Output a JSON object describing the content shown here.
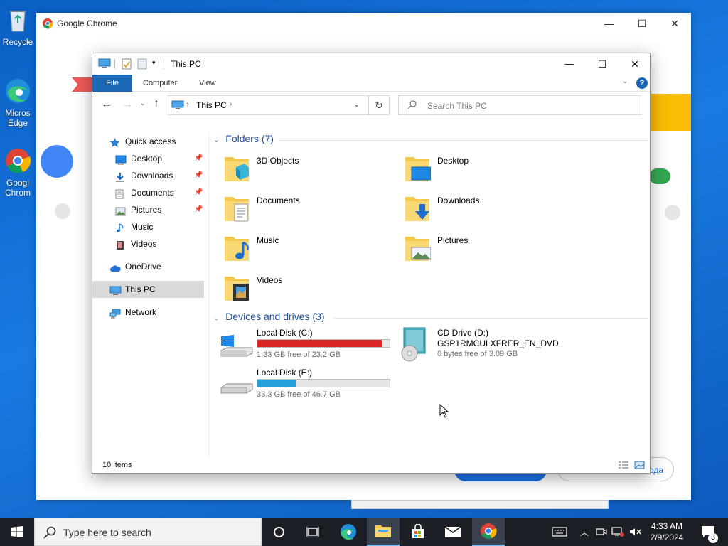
{
  "desktop": {
    "icons": [
      {
        "label": "Recycle"
      },
      {
        "label": "Micros Edge"
      },
      {
        "label": "Googl Chrom"
      }
    ]
  },
  "chrome_window": {
    "title": "Google Chrome",
    "buttons": {
      "minimize": "—",
      "maximize": "☐",
      "close": "✕"
    },
    "background_text": "ода"
  },
  "explorer": {
    "title": "This PC",
    "ribbon_tabs": [
      "File",
      "Computer",
      "View"
    ],
    "help": "?",
    "address": {
      "location": "This PC",
      "search_placeholder": "Search This PC"
    },
    "nav": {
      "quick_access": "Quick access",
      "pinned": [
        "Desktop",
        "Downloads",
        "Documents",
        "Pictures"
      ],
      "unpinned": [
        "Music",
        "Videos"
      ],
      "onedrive": "OneDrive",
      "this_pc": "This PC",
      "network": "Network"
    },
    "folders_header": "Folders (7)",
    "folders": [
      "3D Objects",
      "Desktop",
      "Documents",
      "Downloads",
      "Music",
      "Pictures",
      "Videos"
    ],
    "devices_header": "Devices and drives (3)",
    "drives": [
      {
        "name": "Local Disk (C:)",
        "free": "1.33 GB free of 23.2 GB",
        "used_fraction": 0.94,
        "color": "#da2626"
      },
      {
        "name": "CD Drive (D:)",
        "label": "GSP1RMCULXFRER_EN_DVD",
        "free": "0 bytes free of 3.09 GB"
      },
      {
        "name": "Local Disk (E:)",
        "free": "33.3 GB free of 46.7 GB",
        "used_fraction": 0.29,
        "color": "#26a0da"
      }
    ],
    "status": "10 items"
  },
  "taskbar": {
    "search_placeholder": "Type here to search",
    "time": "4:33 AM",
    "date": "2/9/2024",
    "notification_count": "3"
  },
  "colors": {
    "accent": "#1a67b5",
    "folder": "#f4c64c",
    "taskbar": "#1c2026"
  }
}
